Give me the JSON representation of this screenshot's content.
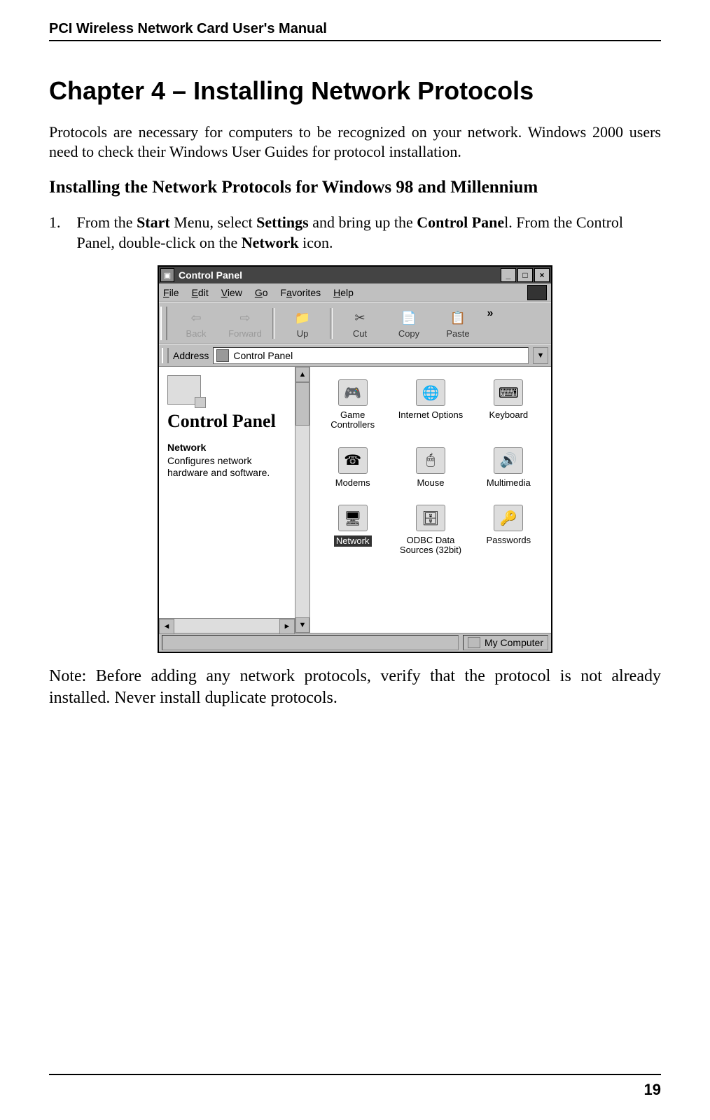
{
  "header": "PCI Wireless Network Card User's Manual",
  "chapter_title": "Chapter 4 – Installing Network Protocols",
  "intro": "Protocols are necessary for computers to be recognized on your network. Windows 2000 users need to check their Windows User Guides for protocol installation.",
  "section_title": "Installing the Network Protocols for Windows 98 and Millennium",
  "step1": {
    "num": "1.",
    "a": "From the ",
    "b": "Start",
    "c": " Menu, select ",
    "d": "Settings",
    "e": " and bring up the ",
    "f": "Control Pane",
    "g": "l. From the Control Panel, double-click on the ",
    "h": "Network",
    "i": " icon."
  },
  "window": {
    "title": "Control Panel",
    "menus": {
      "file": "File",
      "edit": "Edit",
      "view": "View",
      "go": "Go",
      "fav": "Favorites",
      "help": "Help"
    },
    "toolbar": {
      "back": "Back",
      "forward": "Forward",
      "up": "Up",
      "cut": "Cut",
      "copy": "Copy",
      "paste": "Paste",
      "chev": "»"
    },
    "address_label": "Address",
    "address_value": "Control Panel",
    "left": {
      "title": "Control Panel",
      "bold": "Network",
      "desc": "Configures network hardware and software."
    },
    "icons": {
      "game": "Game Controllers",
      "inet": "Internet Options",
      "keyb": "Keyboard",
      "modem": "Modems",
      "mouse": "Mouse",
      "multi": "Multimedia",
      "network": "Network",
      "odbc": "ODBC Data Sources (32bit)",
      "pass": "Passwords"
    },
    "status": "My Computer"
  },
  "note": "Note: Before adding any network protocols, verify that the protocol is not already installed. Never install duplicate protocols.",
  "page_number": "19"
}
